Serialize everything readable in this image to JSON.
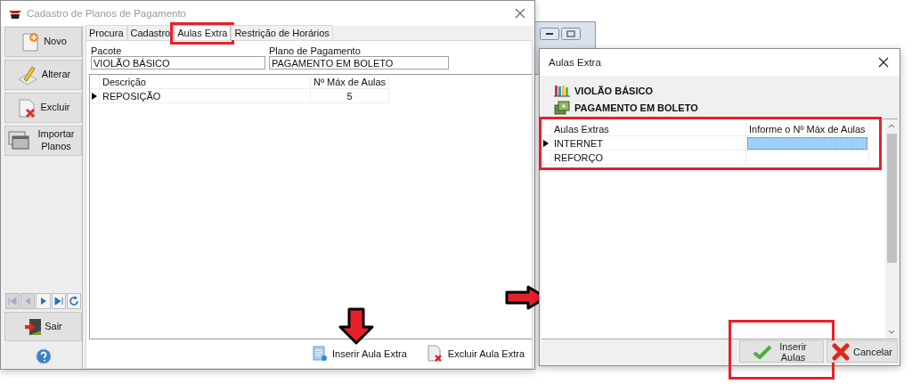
{
  "main_window": {
    "title": "Cadastro de Planos de Pagamento",
    "sidebar": {
      "buttons": [
        {
          "label": "Novo",
          "kind": "new"
        },
        {
          "label": "Alterar",
          "kind": "edit"
        },
        {
          "label": "Excluir",
          "kind": "delete"
        },
        {
          "label": "Importar Planos",
          "kind": "import"
        }
      ],
      "nav_buttons": [
        {
          "kind": "first",
          "disabled": true
        },
        {
          "kind": "prev",
          "disabled": true
        },
        {
          "kind": "next",
          "disabled": false
        },
        {
          "kind": "last",
          "disabled": false
        },
        {
          "kind": "refresh",
          "disabled": false
        }
      ],
      "exit_button": {
        "label": "Sair"
      }
    },
    "tabs": [
      {
        "label": "Procura",
        "selected": false,
        "highlighted": false
      },
      {
        "label": "Cadastro",
        "selected": false,
        "highlighted": false
      },
      {
        "label": "Aulas Extra",
        "selected": true,
        "highlighted": true
      },
      {
        "label": "Restrição de Horários",
        "selected": false,
        "highlighted": false
      }
    ],
    "fields": [
      {
        "label": "Pacote",
        "value": "VIOLÃO BÁSICO"
      },
      {
        "label": "Plano de Pagamento",
        "value": "PAGAMENTO EM BOLETO"
      }
    ],
    "grid": {
      "columns": [
        "Descrição",
        "Nº Máx de Aulas"
      ],
      "rows": [
        {
          "cells": [
            "REPOSIÇÃO",
            "5"
          ],
          "current": true
        }
      ]
    },
    "footer_buttons": [
      {
        "label": "Inserir Aula Extra",
        "kind": "insert",
        "pointed": true
      },
      {
        "label": "Excluir Aula Extra",
        "kind": "remove"
      }
    ]
  },
  "dialog": {
    "title": "Aulas Extra",
    "pointed": true,
    "headings": [
      {
        "text": "VIOLÃO BÁSICO",
        "kind": "books"
      },
      {
        "text": "PAGAMENTO EM BOLETO",
        "kind": "money"
      }
    ],
    "grid": {
      "highlighted": true,
      "columns": [
        "Aulas Extras",
        "Informe o Nº Máx de Aulas"
      ],
      "rows": [
        {
          "name": "INTERNET",
          "current": true
        },
        {
          "name": "REFORÇO",
          "current": false
        }
      ]
    },
    "buttons": [
      {
        "label": "Inserir Aulas",
        "kind": "ok",
        "highlighted": true
      },
      {
        "label": "Cancelar",
        "kind": "cancel",
        "highlighted": false
      }
    ]
  }
}
